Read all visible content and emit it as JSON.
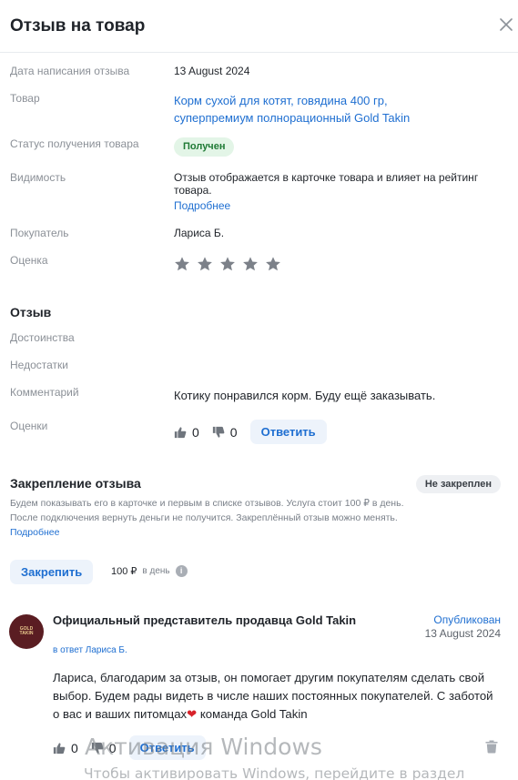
{
  "header": {
    "title": "Отзыв на товар",
    "close_icon": "close-icon"
  },
  "details": {
    "date_label": "Дата написания отзыва",
    "date_value": "13 August 2024",
    "product_label": "Товар",
    "product_line1": "Корм сухой для котят, говядина 400 гр,",
    "product_line2": "суперпремиум полнорационный Gold Takin",
    "status_label": "Статус получения товара",
    "status_value": "Получен",
    "visibility_label": "Видимость",
    "visibility_text": "Отзыв отображается в карточке товара и влияет на рейтинг товара.",
    "visibility_link": "Подробнее",
    "buyer_label": "Покупатель",
    "buyer_value": "Лариса Б.",
    "rating_label": "Оценка",
    "rating_value": 5,
    "rating_max": 5,
    "star_color": "#7c8189"
  },
  "review": {
    "section_title": "Отзыв",
    "pros_label": "Достоинства",
    "cons_label": "Недостатки",
    "comment_label": "Комментарий",
    "comment_value": "Котику понравился корм. Буду ещё заказывать.",
    "ratings_label": "Оценки",
    "likes": "0",
    "dislikes": "0",
    "reply_button": "Ответить"
  },
  "pin": {
    "title": "Закрепление отзыва",
    "status_badge": "Не закреплен",
    "description": "Будем показывать его в карточке и первым в списке отзывов. Услуга стоит 100 ₽ в день. После подключения вернуть деньги не получится. Закреплённый отзыв можно менять.",
    "description_link": "Подробнее",
    "pin_button": "Закрепить",
    "price": "100 ₽",
    "price_period": "в день",
    "info_icon_text": "i"
  },
  "answer": {
    "avatar_text_1": "GOLD",
    "avatar_text_2": "TAKIN",
    "author": "Официальный представитель продавца Gold Takin",
    "status": "Опубликован",
    "date": "13 August 2024",
    "reply_to": "в ответ Лариса Б.",
    "text_part1": "Лариса, благодарим за отзыв, он помогает другим покупателям сделать свой выбор. Будем рады видеть в числе наших постоянных покупателей. С заботой о вас и ваших питомцах",
    "text_heart": "❤",
    "text_part2": " команда Gold Takin",
    "likes": "0",
    "dislikes": "0",
    "reply_button": "Ответить"
  },
  "watermark": {
    "line1": "Активация Windows",
    "line2": "Чтобы активировать Windows, перейдите в раздел"
  },
  "colors": {
    "accent": "#1f6fd1",
    "status_green_bg": "#e3f5e7",
    "status_green_text": "#1f7a35",
    "avatar_bg": "#5a1d22"
  }
}
